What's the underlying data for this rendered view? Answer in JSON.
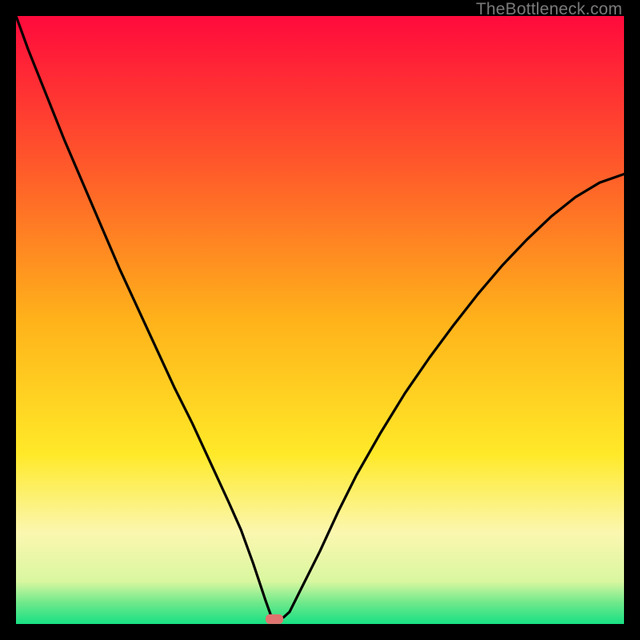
{
  "watermark": "TheBottleneck.com",
  "chart_data": {
    "type": "line",
    "title": "",
    "xlabel": "",
    "ylabel": "",
    "xlim": [
      0,
      100
    ],
    "ylim": [
      0,
      100
    ],
    "curve_note": "V-shaped bottleneck curve; minimum (optimal match) near x≈42. Left branch starts near 100% at x=0 and falls to ~0 at x≈40. Right branch rises from ~0 at x≈45 toward ~74% at x=100.",
    "x": [
      0,
      2,
      5,
      8,
      11,
      14,
      17,
      20,
      23,
      26,
      29,
      32,
      35,
      37,
      39,
      40,
      41,
      42,
      43,
      44,
      45,
      47,
      50,
      53,
      56,
      60,
      64,
      68,
      72,
      76,
      80,
      84,
      88,
      92,
      96,
      100
    ],
    "y": [
      100,
      94.5,
      87,
      79.5,
      72.5,
      65.5,
      58.5,
      52,
      45.5,
      39,
      33,
      26.5,
      20,
      15.5,
      10,
      7,
      4,
      1.2,
      0.9,
      1.1,
      2,
      6,
      12,
      18.5,
      24.5,
      31.5,
      38,
      43.8,
      49.2,
      54.3,
      59,
      63.2,
      67,
      70.2,
      72.6,
      74
    ],
    "optimal_marker": {
      "x": 42.5,
      "y": 0.8
    },
    "background_gradient": {
      "stops": [
        {
          "offset": 0.0,
          "color": "#ff0a3c"
        },
        {
          "offset": 0.25,
          "color": "#ff5a2a"
        },
        {
          "offset": 0.5,
          "color": "#ffb21a"
        },
        {
          "offset": 0.72,
          "color": "#ffe928"
        },
        {
          "offset": 0.85,
          "color": "#fbf7b0"
        },
        {
          "offset": 0.93,
          "color": "#d9f7a0"
        },
        {
          "offset": 0.965,
          "color": "#6fe98b"
        },
        {
          "offset": 1.0,
          "color": "#17e083"
        }
      ]
    }
  }
}
